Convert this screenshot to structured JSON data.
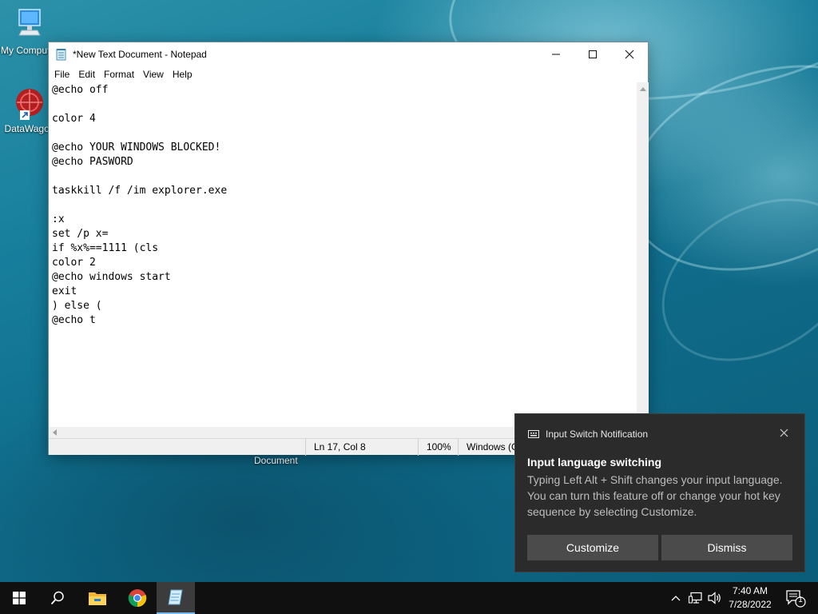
{
  "desktop": {
    "icons": [
      {
        "label": "My Computer",
        "icon": "computer-icon"
      },
      {
        "label": "DataWagon",
        "icon": "datawagon-icon"
      }
    ],
    "document_label": "Document"
  },
  "notepad": {
    "title": "*New Text Document - Notepad",
    "menu": [
      "File",
      "Edit",
      "Format",
      "View",
      "Help"
    ],
    "content": "@echo off\n\ncolor 4\n\n@echo YOUR WINDOWS BLOCKED!\n@echo PASWORD\n\ntaskkill /f /im explorer.exe\n\n:x\nset /p x=\nif %x%==1111 (cls\ncolor 2\n@echo windows start\nexit\n) else (\n@echo t",
    "status": {
      "position": "Ln 17, Col 8",
      "zoom": "100%",
      "encoding": "Windows (C"
    }
  },
  "notification": {
    "source": "Input Switch Notification",
    "title": "Input language switching",
    "body": "Typing Left Alt + Shift changes your input language. You can turn this feature off or change your hot key sequence by selecting Customize.",
    "customize_label": "Customize",
    "dismiss_label": "Dismiss"
  },
  "taskbar": {
    "apps": [
      "start-icon",
      "search-icon",
      "file-explorer-icon",
      "chrome-icon",
      "notepad-icon"
    ],
    "time": "7:40 AM",
    "date": "7/28/2022",
    "notification_count": "1"
  },
  "colors": {
    "taskbar": "#101010",
    "toast_bg": "#2b2b2b",
    "toast_button": "#4b4b4b",
    "active_indicator": "#76b9ed"
  }
}
